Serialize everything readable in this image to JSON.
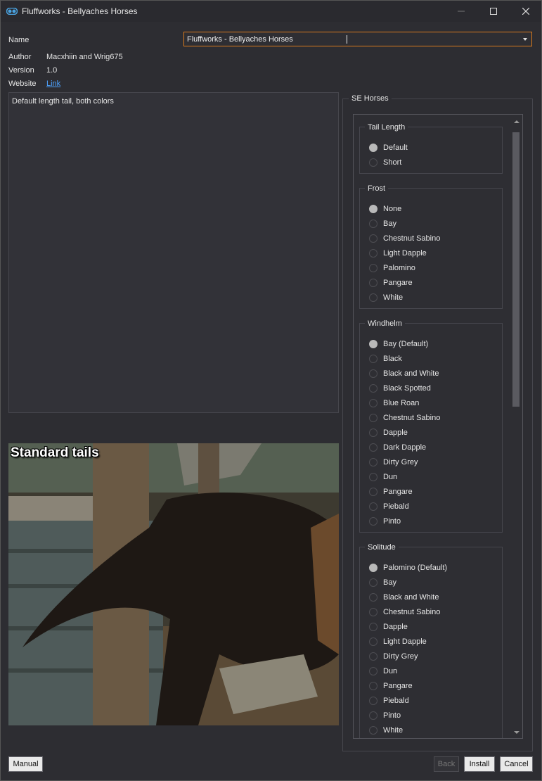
{
  "window": {
    "title": "Fluffworks - Bellyaches Horses"
  },
  "info": {
    "name_label": "Name",
    "name_value": "Fluffworks - Bellyaches Horses",
    "author_label": "Author",
    "author_value": "Macxhiin and Wrig675",
    "version_label": "Version",
    "version_value": "1.0",
    "website_label": "Website",
    "website_link": "Link"
  },
  "description": "Default length tail, both colors",
  "preview": {
    "caption": "Standard tails"
  },
  "options": {
    "title": "SE Horses",
    "groups": [
      {
        "title": "Tail Length",
        "selected": 0,
        "items": [
          "Default",
          "Short"
        ]
      },
      {
        "title": "Frost",
        "selected": 0,
        "items": [
          "None",
          "Bay",
          "Chestnut Sabino",
          "Light Dapple",
          "Palomino",
          "Pangare",
          "White"
        ]
      },
      {
        "title": "Windhelm",
        "selected": 0,
        "items": [
          "Bay (Default)",
          "Black",
          "Black and White",
          "Black Spotted",
          "Blue Roan",
          "Chestnut Sabino",
          "Dapple",
          "Dark Dapple",
          "Dirty Grey",
          "Dun",
          "Pangare",
          "Piebald",
          "Pinto"
        ]
      },
      {
        "title": "Solitude",
        "selected": 0,
        "items": [
          "Palomino (Default)",
          "Bay",
          "Black and White",
          "Chestnut Sabino",
          "Dapple",
          "Light Dapple",
          "Dirty Grey",
          "Dun",
          "Pangare",
          "Piebald",
          "Pinto",
          "White"
        ]
      }
    ]
  },
  "buttons": {
    "manual": "Manual",
    "back": "Back",
    "install": "Install",
    "cancel": "Cancel"
  },
  "colors": {
    "accent": "#d97a1e",
    "link": "#4ea3ff",
    "background": "#2d2d32"
  }
}
